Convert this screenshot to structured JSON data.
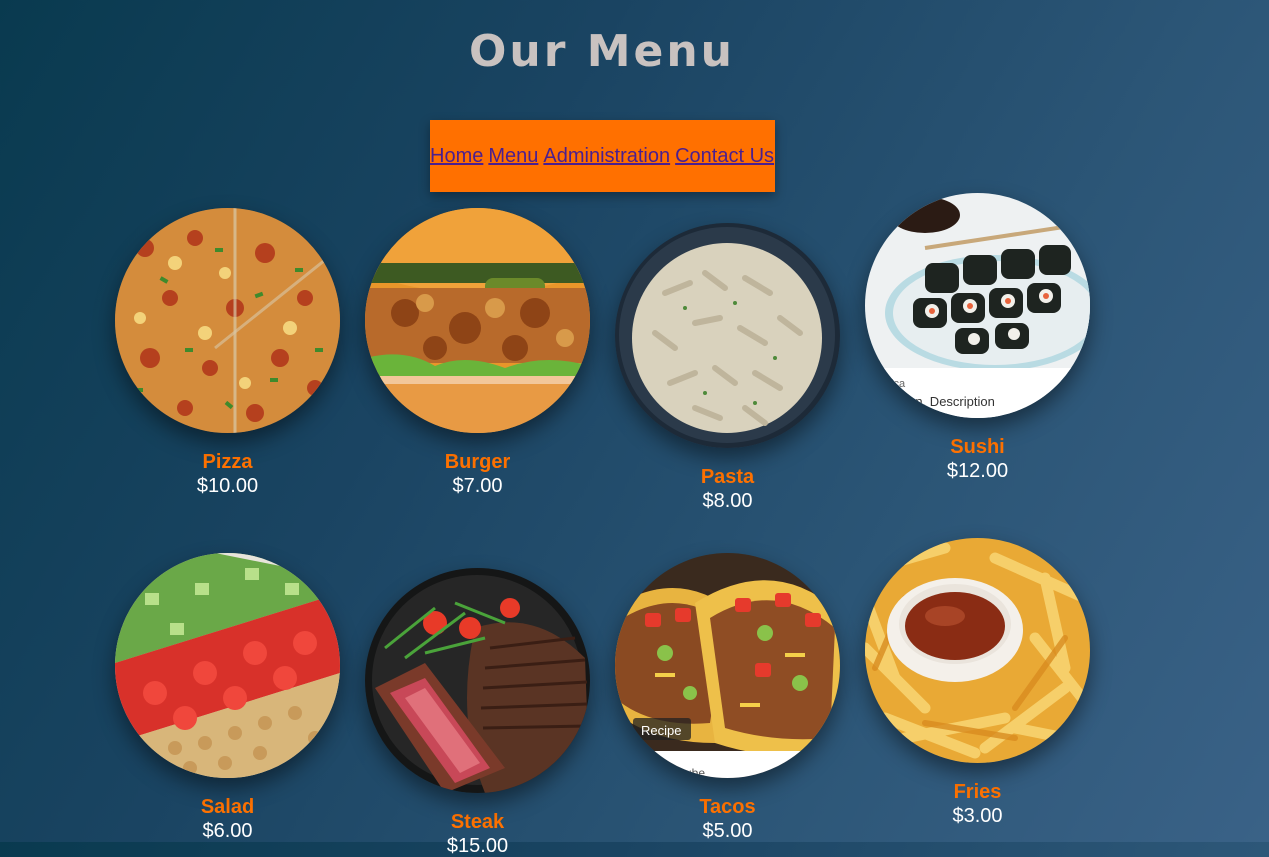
{
  "page": {
    "title": "Our Menu"
  },
  "nav": {
    "items": [
      {
        "label": "Home"
      },
      {
        "label": "Menu"
      },
      {
        "label": "Administration"
      },
      {
        "label": "Contact Us"
      }
    ]
  },
  "menu": {
    "items": [
      {
        "name": "Pizza",
        "price": "$10.00",
        "image_icon": "pizza-image"
      },
      {
        "name": "Burger",
        "price": "$7.00",
        "image_icon": "burger-image"
      },
      {
        "name": "Pasta",
        "price": "$8.00",
        "image_icon": "pasta-image"
      },
      {
        "name": "Sushi",
        "price": "$12.00",
        "image_icon": "sushi-image",
        "image_caption_1": "nica",
        "image_caption_2": "finition, Description"
      },
      {
        "name": "Salad",
        "price": "$6.00",
        "image_icon": "salad-image"
      },
      {
        "name": "Steak",
        "price": "$15.00",
        "image_icon": "steak-image"
      },
      {
        "name": "Tacos",
        "price": "$5.00",
        "image_icon": "tacos-image",
        "image_caption_1": "Recipe",
        "image_caption_2": "ube"
      },
      {
        "name": "Fries",
        "price": "$3.00",
        "image_icon": "fries-image"
      }
    ]
  },
  "colors": {
    "accent": "#ff7000",
    "item_name": "#ff7200",
    "nav_link": "#4b1f8f",
    "title": "#c9c2c0",
    "background_start": "#093a4f",
    "background_end": "#3a6287"
  }
}
